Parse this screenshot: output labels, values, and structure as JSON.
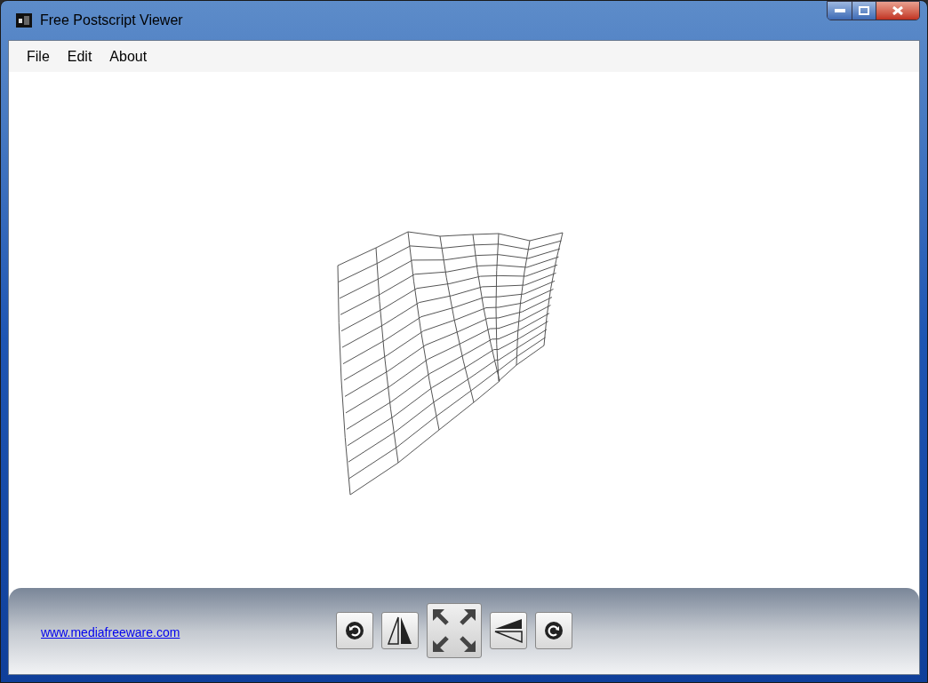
{
  "window": {
    "title": "Free Postscript Viewer"
  },
  "menu": [
    "File",
    "Edit",
    "About"
  ],
  "footer": {
    "link": "www.mediafreeware.com"
  }
}
